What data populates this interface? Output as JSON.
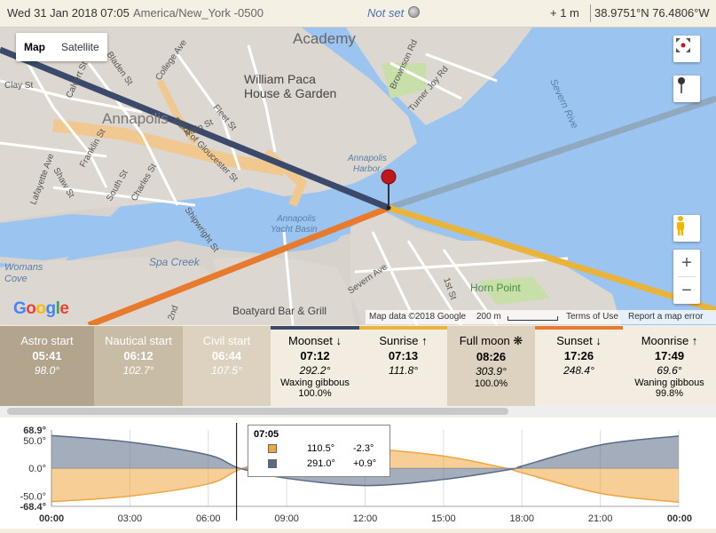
{
  "header": {
    "datetime": "Wed 31 Jan 2018 07:05",
    "timezone": "America/New_York -0500",
    "notset": "Not set",
    "elevation": "+ 1 m",
    "coords": "38.9751°N 76.4806°W"
  },
  "map": {
    "type_map": "Map",
    "type_satellite": "Satellite",
    "labels": {
      "academy": "Academy",
      "william": "William Paca",
      "house": "House & Garden",
      "annapolis": "Annapolis",
      "harbor1": "Annapolis",
      "harbor2": "Harbor",
      "yacht1": "Annapolis",
      "yacht2": "Yacht Basin",
      "spa": "Spa Creek",
      "womans1": "Womans",
      "womans2": "Cove",
      "severn_ave": "Severn Ave",
      "horn": "Horn Point",
      "boatyard": "Boatyard Bar & Grill",
      "severn_river": "Severn Rive",
      "brownson": "Brownson Rd",
      "turner": "Turner Joy Rd",
      "bladen": "Bladen St",
      "college": "College Ave",
      "calvert": "Calvert St",
      "clay": "Clay St",
      "franklin": "Franklin St",
      "shaw": "Shaw St",
      "lafayette": "Lafayette Ave",
      "south": "South St",
      "charles": "Charles St",
      "duke": "Duke of Gloucester St",
      "fleet": "Fleet St",
      "main": "Main St",
      "shipwright": "Shipwright St",
      "first": "1st St",
      "second": "2nd"
    },
    "attribution": {
      "data": "Map data ©2018 Google",
      "scale": "200 m",
      "terms": "Terms of Use",
      "report": "Report a map error"
    },
    "google": "Google"
  },
  "events": [
    {
      "name": "Astro start",
      "time": "05:41",
      "angle": "98.0°",
      "phase": "",
      "pct": "",
      "bg": "#b3a48e"
    },
    {
      "name": "Nautical start",
      "time": "06:12",
      "angle": "102.7°",
      "phase": "",
      "pct": "",
      "bg": "#c9bca6"
    },
    {
      "name": "Civil start",
      "time": "06:44",
      "angle": "107.5°",
      "phase": "",
      "pct": "",
      "bg": "#ddd2bf"
    },
    {
      "name": "Moonset ↓",
      "time": "07:12",
      "angle": "292.2°",
      "phase": "Waxing gibbous",
      "pct": "100.0%",
      "bg": "#f2ece1",
      "bar": "#3b4a6b"
    },
    {
      "name": "Sunrise ↑",
      "time": "07:13",
      "angle": "111.8°",
      "phase": "",
      "pct": "",
      "bg": "#f2ece1",
      "bar": "#e8b43c"
    },
    {
      "name": "Full moon ❋",
      "time": "08:26",
      "angle": "303.9°",
      "phase": "",
      "pct": "100.0%",
      "bg": "#ddd2bf"
    },
    {
      "name": "Sunset ↓",
      "time": "17:26",
      "angle": "248.4°",
      "phase": "",
      "pct": "",
      "bg": "#f2ece1",
      "bar": "#e87a2e"
    },
    {
      "name": "Moonrise ↑",
      "time": "17:49",
      "angle": "69.6°",
      "phase": "Waning gibbous",
      "pct": "99.8%",
      "bg": "#f2ece1"
    }
  ],
  "chart_data": {
    "type": "area",
    "x_ticks": [
      "00:00",
      "03:00",
      "06:00",
      "09:00",
      "12:00",
      "15:00",
      "18:00",
      "21:00",
      "00:00"
    ],
    "y_ticks": [
      "68.9°",
      "50.0°",
      "0.0°",
      "-50.0°",
      "-68.4°"
    ],
    "ylim": [
      -68.4,
      68.9
    ],
    "series": [
      {
        "color": "#f0a640",
        "points": [
          [
            0,
            -60
          ],
          [
            3,
            -50
          ],
          [
            6,
            -28
          ],
          [
            7.2,
            -2.3
          ],
          [
            9,
            22
          ],
          [
            12,
            34
          ],
          [
            15,
            22
          ],
          [
            17.4,
            0
          ],
          [
            18,
            -8
          ],
          [
            21,
            -45
          ],
          [
            24,
            -61
          ]
        ]
      },
      {
        "color": "#5a6a85",
        "points": [
          [
            0,
            59
          ],
          [
            3,
            47
          ],
          [
            6,
            24
          ],
          [
            7.2,
            0
          ],
          [
            9,
            -18
          ],
          [
            12,
            -31
          ],
          [
            15,
            -20
          ],
          [
            17.8,
            0
          ],
          [
            18,
            4
          ],
          [
            21,
            42
          ],
          [
            24,
            58
          ]
        ]
      }
    ],
    "cursor_time": 7.083
  },
  "tooltip": {
    "time": "07:05",
    "sun_az": "110.5°",
    "sun_alt": "-2.3°",
    "moon_az": "291.0°",
    "moon_alt": "+0.9°"
  }
}
